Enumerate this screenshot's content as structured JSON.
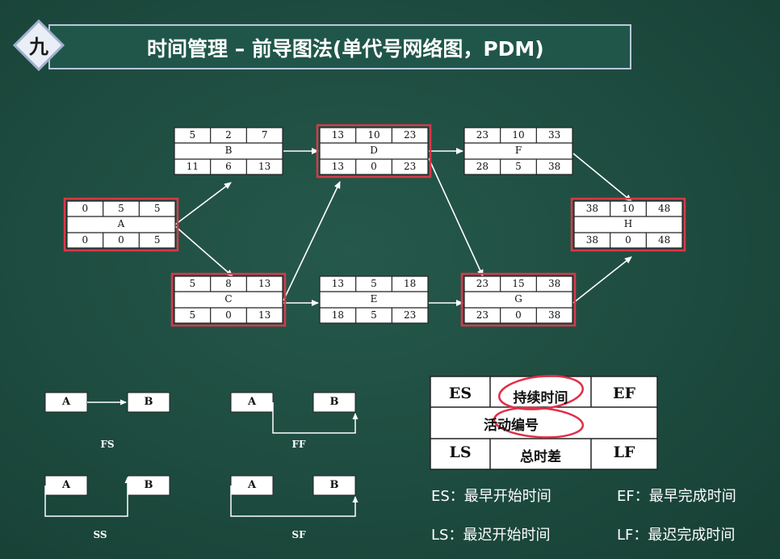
{
  "header": {
    "badge": "九",
    "title": "时间管理 – 前导图法(单代号网络图，PDM)"
  },
  "network": {
    "nodes": [
      {
        "id": "A",
        "es": "0",
        "dur": "5",
        "ef": "5",
        "ls": "0",
        "tf": "0",
        "lf": "5",
        "critical": true
      },
      {
        "id": "B",
        "es": "5",
        "dur": "2",
        "ef": "7",
        "ls": "11",
        "tf": "6",
        "lf": "13",
        "critical": false
      },
      {
        "id": "C",
        "es": "5",
        "dur": "8",
        "ef": "13",
        "ls": "5",
        "tf": "0",
        "lf": "13",
        "critical": true
      },
      {
        "id": "D",
        "es": "13",
        "dur": "10",
        "ef": "23",
        "ls": "13",
        "tf": "0",
        "lf": "23",
        "critical": true
      },
      {
        "id": "E",
        "es": "13",
        "dur": "5",
        "ef": "18",
        "ls": "18",
        "tf": "5",
        "lf": "23",
        "critical": false
      },
      {
        "id": "F",
        "es": "23",
        "dur": "10",
        "ef": "33",
        "ls": "28",
        "tf": "5",
        "lf": "38",
        "critical": false
      },
      {
        "id": "G",
        "es": "23",
        "dur": "15",
        "ef": "38",
        "ls": "23",
        "tf": "0",
        "lf": "38",
        "critical": true
      },
      {
        "id": "H",
        "es": "38",
        "dur": "10",
        "ef": "48",
        "ls": "38",
        "tf": "0",
        "lf": "48",
        "critical": true
      }
    ],
    "edges": [
      [
        "A",
        "B"
      ],
      [
        "A",
        "C"
      ],
      [
        "B",
        "D"
      ],
      [
        "C",
        "D"
      ],
      [
        "C",
        "E"
      ],
      [
        "D",
        "F"
      ],
      [
        "D",
        "G"
      ],
      [
        "E",
        "G"
      ],
      [
        "F",
        "H"
      ],
      [
        "G",
        "H"
      ]
    ]
  },
  "dependencies": [
    {
      "label": "FS",
      "from": "A",
      "to": "B"
    },
    {
      "label": "FF",
      "from": "A",
      "to": "B"
    },
    {
      "label": "SS",
      "from": "A",
      "to": "B"
    },
    {
      "label": "SF",
      "from": "A",
      "to": "B"
    }
  ],
  "legend": {
    "es": "ES",
    "duration": "持续时间",
    "ef": "EF",
    "activity": "活动编号",
    "ls": "LS",
    "total_float": "总时差",
    "lf": "LF"
  },
  "definitions": {
    "es": "ES：最早开始时间",
    "ef": "EF：最早完成时间",
    "ls": "LS：最迟开始时间",
    "lf": "LF：最迟完成时间"
  },
  "colors": {
    "board": "#1e4f42",
    "critical_border": "#d9384a",
    "highlight_circle": "#e0304a"
  }
}
